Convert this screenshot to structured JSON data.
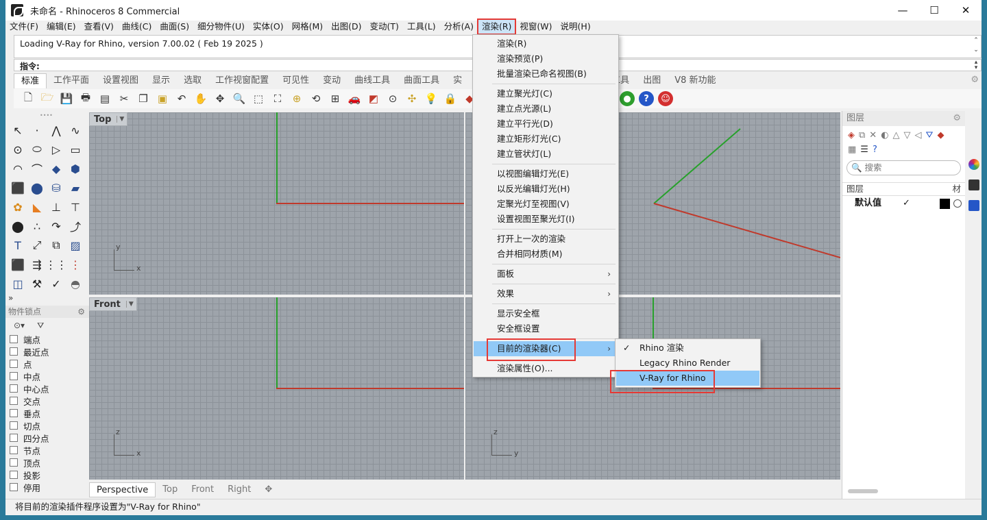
{
  "window": {
    "title": "未命名 - Rhinoceros 8 Commercial",
    "controls": [
      "—",
      "☐",
      "✕"
    ]
  },
  "menubar": {
    "items": [
      "文件(F)",
      "编辑(E)",
      "查看(V)",
      "曲线(C)",
      "曲面(S)",
      "细分物件(U)",
      "实体(O)",
      "网格(M)",
      "出图(D)",
      "变动(T)",
      "工具(L)",
      "分析(A)",
      "渲染(R)",
      "视窗(W)",
      "说明(H)"
    ],
    "active": "渲染(R)"
  },
  "command": {
    "history": "Loading V-Ray for Rhino, version 7.00.02 ( Feb 19 2025 )",
    "prompt_label": "指令:"
  },
  "tabs": {
    "items": [
      "标准",
      "工作平面",
      "设置视图",
      "显示",
      "选取",
      "工作视窗配置",
      "可见性",
      "变动",
      "曲线工具",
      "曲面工具",
      "实",
      "渲染工具",
      "出图",
      "V8 新功能"
    ],
    "selected": "标准"
  },
  "snaps": {
    "header": "物件锁点",
    "items": [
      "端点",
      "最近点",
      "点",
      "中点",
      "中心点",
      "交点",
      "垂点",
      "切点",
      "四分点",
      "节点",
      "顶点",
      "投影",
      "停用"
    ]
  },
  "viewports": {
    "top_label": "Top",
    "front_label": "Front",
    "top_axes": {
      "y": "y",
      "x": "x"
    },
    "front_axes": {
      "z": "z",
      "x": "x"
    },
    "right_axes": {
      "z": "z",
      "y": "y"
    }
  },
  "viewport_tabs": [
    "Perspective",
    "Top",
    "Front",
    "Right",
    "✥"
  ],
  "status": "将目前的渲染插件程序设置为\"V-Ray for Rhino\"",
  "layers_panel": {
    "title": "图层",
    "search_placeholder": "搜索",
    "column_header": "图层",
    "column_material": "材",
    "default_layer": "默认值",
    "check": "✓"
  },
  "render_menu": {
    "items": [
      "渲染(R)",
      "渲染预览(P)",
      "批量渲染已命名视图(B)",
      "建立聚光灯(C)",
      "建立点光源(L)",
      "建立平行光(D)",
      "建立矩形灯光(C)",
      "建立管状灯(L)",
      "以视图编辑灯光(E)",
      "以反光编辑灯光(H)",
      "定聚光灯至视图(V)",
      "设置视图至聚光灯(I)",
      "打开上一次的渲染",
      "合并相同材质(M)",
      "面板",
      "效果",
      "显示安全框",
      "安全框设置",
      "目前的渲染器(C)",
      "渲染属性(O)..."
    ]
  },
  "renderer_submenu": {
    "items": [
      "Rhino 渲染",
      "Legacy Rhino Render",
      "V-Ray for Rhino"
    ],
    "checked": "Rhino 渲染",
    "highlighted": "V-Ray for Rhino"
  },
  "colors": {
    "x_axis": "#c0392b",
    "y_axis": "#27a12b",
    "highlight": "#91c9f7",
    "annotation_red": "#e53935"
  }
}
